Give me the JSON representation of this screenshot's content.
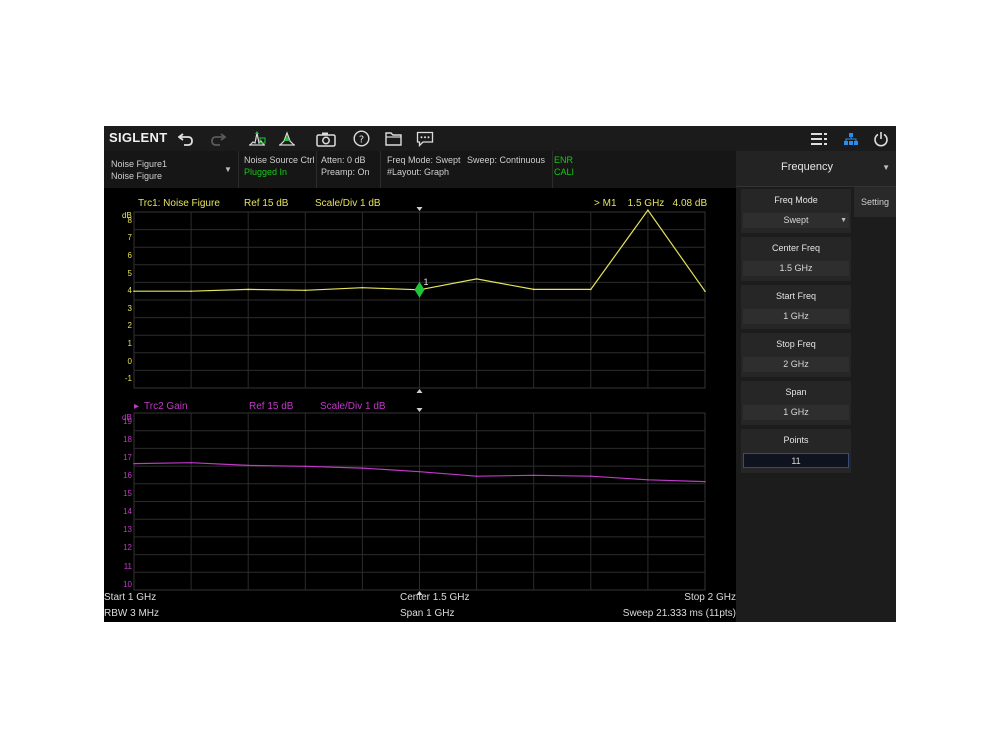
{
  "brand": "SIGLENT",
  "toolbar": {
    "icons": [
      "undo-icon",
      "redo-icon",
      "peak-search-icon",
      "marker-icon",
      "camera-icon",
      "help-icon",
      "folder-icon",
      "message-icon",
      "menu-list-icon",
      "network-icon",
      "power-icon"
    ]
  },
  "info": {
    "measurement": {
      "line1": "Noise Figure1",
      "line2": "Noise Figure"
    },
    "noise_source": {
      "line1": "Noise Source Ctrl",
      "line2": "Plugged In"
    },
    "atten": {
      "line1": "Atten: 0 dB",
      "line2": "Preamp: On"
    },
    "freq": {
      "line1": "Freq Mode: Swept",
      "line2": "#Layout: Graph"
    },
    "sweep": {
      "line1": "Sweep: Continuous"
    },
    "enr": {
      "line1": "ENR",
      "line2": "CALI"
    }
  },
  "trace1": {
    "label": "Trc1:  Noise Figure",
    "ref": "Ref  15 dB",
    "scale": "Scale/Div  1 dB",
    "marker_readout": "> M1    1.5 GHz   4.08 dB",
    "unit": "dB",
    "y_ticks": [
      "8",
      "7",
      "6",
      "5",
      "4",
      "3",
      "2",
      "1",
      "0",
      "-1"
    ],
    "marker_label": "1",
    "color": "#e6e35c"
  },
  "trace2": {
    "label": "Trc2  Gain",
    "ref": "Ref  15 dB",
    "scale": "Scale/Div  1 dB",
    "unit": "dB",
    "y_ticks": [
      "19",
      "18",
      "17",
      "16",
      "15",
      "14",
      "13",
      "12",
      "11",
      "10"
    ],
    "color": "#c238c8"
  },
  "chart_data": [
    {
      "type": "line",
      "x": [
        1.0,
        1.1,
        1.2,
        1.3,
        1.4,
        1.5,
        1.6,
        1.7,
        1.8,
        1.9,
        2.0
      ],
      "series": [
        {
          "name": "Trc1:  Noise Figure",
          "values": [
            4.0,
            4.0,
            4.1,
            4.05,
            4.2,
            4.08,
            4.7,
            4.1,
            4.1,
            8.6,
            4.0
          ]
        }
      ],
      "ylim": [
        -1.5,
        8.5
      ],
      "marker": {
        "label": "1",
        "x": 1.5,
        "y": 4.08
      }
    },
    {
      "type": "line",
      "x": [
        1.0,
        1.1,
        1.2,
        1.3,
        1.4,
        1.5,
        1.6,
        1.7,
        1.8,
        1.9,
        2.0
      ],
      "series": [
        {
          "name": "Trc2  Gain",
          "values": [
            16.7,
            16.75,
            16.6,
            16.55,
            16.45,
            16.25,
            16.0,
            16.05,
            16.0,
            15.8,
            15.7
          ]
        }
      ],
      "ylim": [
        9.7,
        19.5
      ]
    }
  ],
  "status": {
    "start": "Start  1 GHz",
    "center": "Center  1.5 GHz",
    "stop": "Stop  2 GHz",
    "rbw": "RBW  3 MHz",
    "span": "Span  1 GHz",
    "sweep": "Sweep  21.333 ms (11pts)"
  },
  "panel": {
    "title": "Frequency",
    "tab": "Setting",
    "params": [
      {
        "label": "Freq Mode",
        "value": "Swept"
      },
      {
        "label": "Center Freq",
        "value": "1.5 GHz"
      },
      {
        "label": "Start Freq",
        "value": "1 GHz"
      },
      {
        "label": "Stop Freq",
        "value": "2 GHz"
      },
      {
        "label": "Span",
        "value": "1 GHz"
      },
      {
        "label": "Points",
        "value": "11"
      }
    ]
  }
}
